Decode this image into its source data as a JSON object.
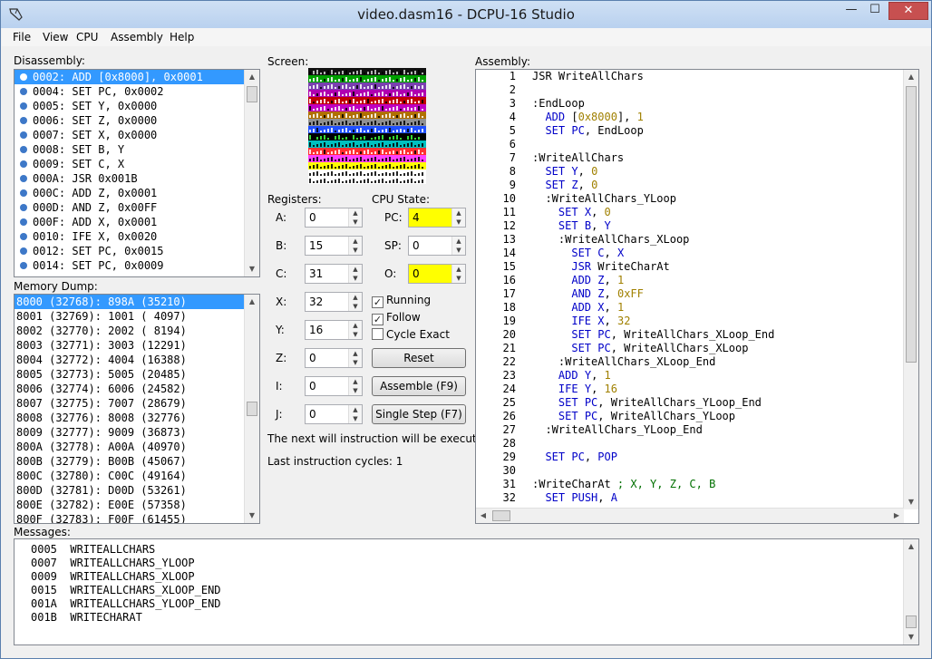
{
  "window": {
    "title": "video.dasm16 - DCPU-16 Studio",
    "minimize": "—",
    "maximize": "☐",
    "close": "✕"
  },
  "menu": [
    "File",
    "View",
    "CPU",
    "Assembly",
    "Help"
  ],
  "labels": {
    "disassembly": "Disassembly:",
    "memory_dump": "Memory Dump:",
    "screen": "Screen:",
    "registers": "Registers:",
    "cpu_state": "CPU State:",
    "assembly": "Assembly:",
    "messages": "Messages:"
  },
  "disassembly": [
    "0002: ADD [0x8000], 0x0001",
    "0004: SET PC, 0x0002",
    "0005: SET Y, 0x0000",
    "0006: SET Z, 0x0000",
    "0007: SET X, 0x0000",
    "0008: SET B, Y",
    "0009: SET C, X",
    "000A: JSR 0x001B",
    "000C: ADD Z, 0x0001",
    "000D: AND Z, 0x00FF",
    "000F: ADD X, 0x0001",
    "0010: IFE X, 0x0020",
    "0012: SET PC, 0x0015",
    "0014: SET PC, 0x0009"
  ],
  "memory_dump": [
    "8000 (32768): 898A (35210)",
    "8001 (32769): 1001 ( 4097)",
    "8002 (32770): 2002 ( 8194)",
    "8003 (32771): 3003 (12291)",
    "8004 (32772): 4004 (16388)",
    "8005 (32773): 5005 (20485)",
    "8006 (32774): 6006 (24582)",
    "8007 (32775): 7007 (28679)",
    "8008 (32776): 8008 (32776)",
    "8009 (32777): 9009 (36873)",
    "800A (32778): A00A (40970)",
    "800B (32779): B00B (45067)",
    "800C (32780): C00C (49164)",
    "800D (32781): D00D (53261)",
    "800E (32782): E00E (57358)",
    "800F (32783): F00F (61455)"
  ],
  "registers": [
    {
      "name": "A:",
      "value": "0"
    },
    {
      "name": "B:",
      "value": "15"
    },
    {
      "name": "C:",
      "value": "31"
    },
    {
      "name": "X:",
      "value": "32"
    },
    {
      "name": "Y:",
      "value": "16"
    },
    {
      "name": "Z:",
      "value": "0"
    },
    {
      "name": "I:",
      "value": "0"
    },
    {
      "name": "J:",
      "value": "0"
    }
  ],
  "cpu_state": [
    {
      "name": "PC:",
      "value": "4",
      "highlight": true
    },
    {
      "name": "SP:",
      "value": "0",
      "highlight": false
    },
    {
      "name": "O:",
      "value": "0",
      "highlight": true
    }
  ],
  "options": [
    {
      "label": "Running",
      "checked": true
    },
    {
      "label": "Follow",
      "checked": true
    },
    {
      "label": "Cycle Exact",
      "checked": false
    }
  ],
  "buttons": {
    "reset": "Reset",
    "assemble": "Assemble (F9)",
    "step": "Single Step (F7)"
  },
  "status": {
    "next": "The next will instruction will be executed",
    "cycles": "Last instruction cycles: 1"
  },
  "assembly_lines": [
    [
      [
        "",
        "JSR WriteAllChars"
      ]
    ],
    [],
    [
      [
        "",
        ":EndLoop"
      ]
    ],
    [
      [
        "",
        "  "
      ],
      [
        "kw",
        "ADD"
      ],
      [
        "",
        " ["
      ],
      [
        "num",
        "0x8000"
      ],
      [
        "",
        "], "
      ],
      [
        "num",
        "1"
      ]
    ],
    [
      [
        "",
        "  "
      ],
      [
        "kw",
        "SET"
      ],
      [
        "",
        " "
      ],
      [
        "kw",
        "PC"
      ],
      [
        "",
        ", EndLoop"
      ]
    ],
    [],
    [
      [
        "",
        ":WriteAllChars"
      ]
    ],
    [
      [
        "",
        "  "
      ],
      [
        "kw",
        "SET"
      ],
      [
        "",
        " "
      ],
      [
        "kw",
        "Y"
      ],
      [
        "",
        ", "
      ],
      [
        "num",
        "0"
      ]
    ],
    [
      [
        "",
        "  "
      ],
      [
        "kw",
        "SET"
      ],
      [
        "",
        " "
      ],
      [
        "kw",
        "Z"
      ],
      [
        "",
        ", "
      ],
      [
        "num",
        "0"
      ]
    ],
    [
      [
        "",
        "  :WriteAllChars_YLoop"
      ]
    ],
    [
      [
        "",
        "    "
      ],
      [
        "kw",
        "SET"
      ],
      [
        "",
        " "
      ],
      [
        "kw",
        "X"
      ],
      [
        "",
        ", "
      ],
      [
        "num",
        "0"
      ]
    ],
    [
      [
        "",
        "    "
      ],
      [
        "kw",
        "SET"
      ],
      [
        "",
        " "
      ],
      [
        "kw",
        "B"
      ],
      [
        "",
        ", "
      ],
      [
        "kw",
        "Y"
      ]
    ],
    [
      [
        "",
        "    :WriteAllChars_XLoop"
      ]
    ],
    [
      [
        "",
        "      "
      ],
      [
        "kw",
        "SET"
      ],
      [
        "",
        " "
      ],
      [
        "kw",
        "C"
      ],
      [
        "",
        ", "
      ],
      [
        "kw",
        "X"
      ]
    ],
    [
      [
        "",
        "      "
      ],
      [
        "kw",
        "JSR"
      ],
      [
        "",
        " WriteCharAt"
      ]
    ],
    [
      [
        "",
        "      "
      ],
      [
        "kw",
        "ADD"
      ],
      [
        "",
        " "
      ],
      [
        "kw",
        "Z"
      ],
      [
        "",
        ", "
      ],
      [
        "num",
        "1"
      ]
    ],
    [
      [
        "",
        "      "
      ],
      [
        "kw",
        "AND"
      ],
      [
        "",
        " "
      ],
      [
        "kw",
        "Z"
      ],
      [
        "",
        ", "
      ],
      [
        "num",
        "0xFF"
      ]
    ],
    [
      [
        "",
        "      "
      ],
      [
        "kw",
        "ADD"
      ],
      [
        "",
        " "
      ],
      [
        "kw",
        "X"
      ],
      [
        "",
        ", "
      ],
      [
        "num",
        "1"
      ]
    ],
    [
      [
        "",
        "      "
      ],
      [
        "kw",
        "IFE"
      ],
      [
        "",
        " "
      ],
      [
        "kw",
        "X"
      ],
      [
        "",
        ", "
      ],
      [
        "num",
        "32"
      ]
    ],
    [
      [
        "",
        "      "
      ],
      [
        "kw",
        "SET"
      ],
      [
        "",
        " "
      ],
      [
        "kw",
        "PC"
      ],
      [
        "",
        ", WriteAllChars_XLoop_End"
      ]
    ],
    [
      [
        "",
        "      "
      ],
      [
        "kw",
        "SET"
      ],
      [
        "",
        " "
      ],
      [
        "kw",
        "PC"
      ],
      [
        "",
        ", WriteAllChars_XLoop"
      ]
    ],
    [
      [
        "",
        "    :WriteAllChars_XLoop_End"
      ]
    ],
    [
      [
        "",
        "    "
      ],
      [
        "kw",
        "ADD"
      ],
      [
        "",
        " "
      ],
      [
        "kw",
        "Y"
      ],
      [
        "",
        ", "
      ],
      [
        "num",
        "1"
      ]
    ],
    [
      [
        "",
        "    "
      ],
      [
        "kw",
        "IFE"
      ],
      [
        "",
        " "
      ],
      [
        "kw",
        "Y"
      ],
      [
        "",
        ", "
      ],
      [
        "num",
        "16"
      ]
    ],
    [
      [
        "",
        "    "
      ],
      [
        "kw",
        "SET"
      ],
      [
        "",
        " "
      ],
      [
        "kw",
        "PC"
      ],
      [
        "",
        ", WriteAllChars_YLoop_End"
      ]
    ],
    [
      [
        "",
        "    "
      ],
      [
        "kw",
        "SET"
      ],
      [
        "",
        " "
      ],
      [
        "kw",
        "PC"
      ],
      [
        "",
        ", WriteAllChars_YLoop"
      ]
    ],
    [
      [
        "",
        "  :WriteAllChars_YLoop_End"
      ]
    ],
    [],
    [
      [
        "",
        "  "
      ],
      [
        "kw",
        "SET"
      ],
      [
        "",
        " "
      ],
      [
        "kw",
        "PC"
      ],
      [
        "",
        ", "
      ],
      [
        "kw",
        "POP"
      ]
    ],
    [],
    [
      [
        "",
        ":WriteCharAt "
      ],
      [
        "cm",
        "; X, Y, Z, C, B"
      ]
    ],
    [
      [
        "",
        "  "
      ],
      [
        "kw",
        "SET"
      ],
      [
        "",
        " "
      ],
      [
        "kw",
        "PUSH"
      ],
      [
        "",
        ", "
      ],
      [
        "kw",
        "A"
      ]
    ]
  ],
  "messages": [
    "0005  WRITEALLCHARS",
    "0007  WRITEALLCHARS_YLOOP",
    "0009  WRITEALLCHARS_XLOOP",
    "0015  WRITEALLCHARS_XLOOP_END",
    "001A  WRITEALLCHARS_YLOOP_END",
    "001B  WRITECHARAT"
  ],
  "screen_rows": [
    {
      "bg": "#101010",
      "fg": "#cfcfcf"
    },
    {
      "bg": "#00a000",
      "fg": "#ffffff"
    },
    {
      "bg": "#7a3fb0",
      "fg": "#ffffff"
    },
    {
      "bg": "#b000b0",
      "fg": "#ffffff"
    },
    {
      "bg": "#c00000",
      "fg": "#ffffff"
    },
    {
      "bg": "#c000c0",
      "fg": "#ffffff"
    },
    {
      "bg": "#b07000",
      "fg": "#ffffff"
    },
    {
      "bg": "#909090",
      "fg": "#000000"
    },
    {
      "bg": "#2050ff",
      "fg": "#ffffff"
    },
    {
      "bg": "#000000",
      "fg": "#40ff40"
    },
    {
      "bg": "#00c0c0",
      "fg": "#000000"
    },
    {
      "bg": "#ff3030",
      "fg": "#ffffff"
    },
    {
      "bg": "#ff40ff",
      "fg": "#000000"
    },
    {
      "bg": "#ffff00",
      "fg": "#000000"
    },
    {
      "bg": "#ffffff",
      "fg": "#000000"
    },
    {
      "bg": "#ffffff",
      "fg": "#000000"
    }
  ]
}
